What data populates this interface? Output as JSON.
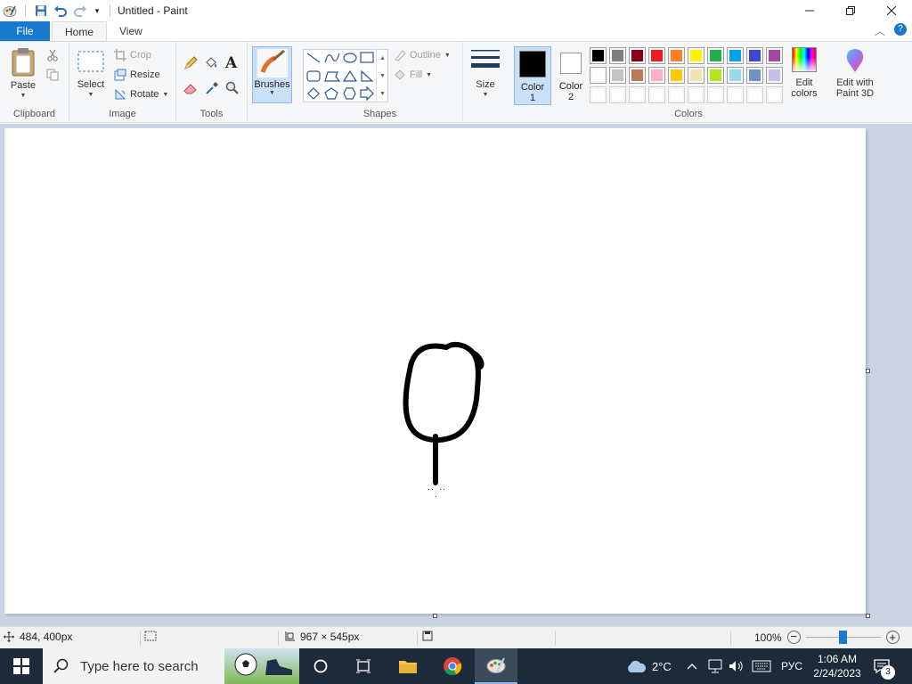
{
  "window": {
    "title": "Untitled - Paint"
  },
  "quick_access": {
    "icons": [
      "paint-app-icon",
      "save-icon",
      "undo-icon",
      "redo-icon",
      "customize-dropdown-icon"
    ]
  },
  "tabs": {
    "file": "File",
    "home": "Home",
    "view": "View"
  },
  "ribbon": {
    "clipboard": {
      "paste": "Paste",
      "group_label": "Clipboard"
    },
    "image": {
      "select": "Select",
      "crop": "Crop",
      "resize": "Resize",
      "rotate": "Rotate",
      "group_label": "Image"
    },
    "tools": {
      "group_label": "Tools"
    },
    "brushes": {
      "label": "Brushes"
    },
    "shapes": {
      "outline": "Outline",
      "fill": "Fill",
      "group_label": "Shapes"
    },
    "size": {
      "label": "Size"
    },
    "color1": {
      "label_line1": "Color",
      "label_line2": "1",
      "color": "#000000"
    },
    "color2": {
      "label_line1": "Color",
      "label_line2": "2",
      "color": "#ffffff"
    },
    "colors": {
      "group_label": "Colors",
      "row1": [
        "#000000",
        "#7f7f7f",
        "#880015",
        "#ed1c24",
        "#ff7f27",
        "#fff200",
        "#22b14c",
        "#00a2e8",
        "#3f48cc",
        "#a349a4"
      ],
      "row2": [
        "#ffffff",
        "#c3c3c3",
        "#b97a57",
        "#ffaec9",
        "#ffc90e",
        "#efe4b0",
        "#b5e61d",
        "#99d9ea",
        "#7092be",
        "#c8bfe7"
      ],
      "row3": [
        "#ffffff",
        "#ffffff",
        "#ffffff",
        "#ffffff",
        "#ffffff",
        "#ffffff",
        "#ffffff",
        "#ffffff",
        "#ffffff",
        "#ffffff"
      ]
    },
    "edit_colors": {
      "line1": "Edit",
      "line2": "colors"
    },
    "paint3d": {
      "line1": "Edit with",
      "line2": "Paint 3D"
    }
  },
  "status": {
    "cursor_pos": "484, 400px",
    "canvas_size": "967 × 545px",
    "zoom": "100%",
    "zoom_level": 0.5
  },
  "taskbar": {
    "search_placeholder": "Type here to search",
    "weather": "2°C",
    "language": "РУС",
    "time": "1:06 AM",
    "date": "2/24/2023",
    "notifications": "3"
  }
}
